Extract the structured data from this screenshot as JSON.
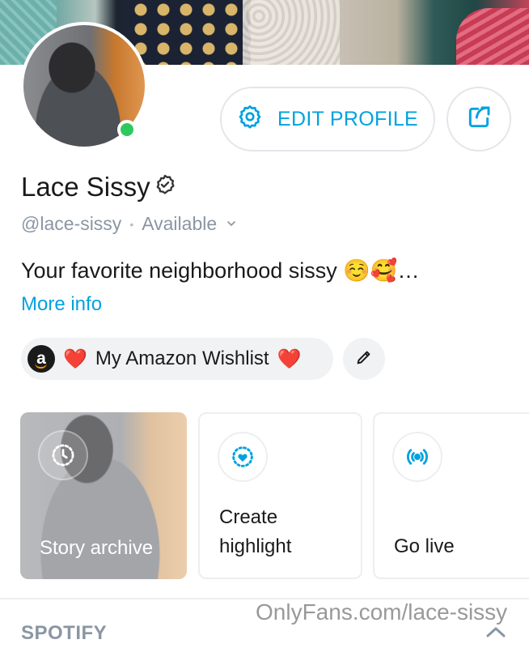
{
  "profile": {
    "name": "Lace Sissy",
    "handle": "@lace-sissy",
    "separator": "•",
    "status": "Available",
    "bio": "Your favorite neighborhood sissy ☺️🥰…",
    "more_info": "More info"
  },
  "actions": {
    "edit_profile": "EDIT PROFILE"
  },
  "wishlist": {
    "amazon_letter": "a",
    "heart": "❤️",
    "label": "My Amazon Wishlist"
  },
  "cards": [
    {
      "label": "Story archive",
      "icon": "clock-icon"
    },
    {
      "label_line1": "Create",
      "label_line2": "highlight",
      "icon": "add-highlight-icon"
    },
    {
      "label": "Go live",
      "icon": "broadcast-icon"
    }
  ],
  "sections": {
    "spotify": "SPOTIFY"
  },
  "watermark": "OnlyFans.com/lace-sissy",
  "colors": {
    "accent": "#00a2e0",
    "online": "#2ec95c",
    "muted": "#8a96a3"
  }
}
